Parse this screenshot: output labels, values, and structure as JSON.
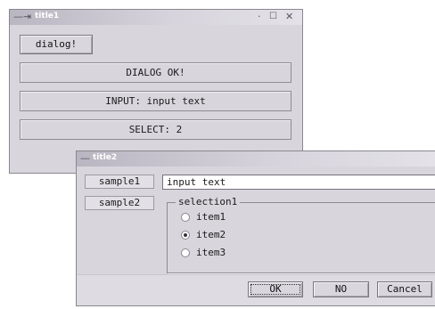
{
  "window1": {
    "title": "title1",
    "dialog_button": "dialog!",
    "status_dialog": "DIALOG OK!",
    "status_input": "INPUT: input text",
    "status_select": "SELECT: 2"
  },
  "window2": {
    "title": "title2",
    "labels": [
      "sample1",
      "sample2"
    ],
    "text_value": "input text",
    "group_title": "selection1",
    "radio_items": [
      {
        "label": "item1",
        "checked": false
      },
      {
        "label": "item2",
        "checked": true
      },
      {
        "label": "item3",
        "checked": false
      }
    ],
    "buttons": {
      "ok": "OK",
      "no": "NO",
      "cancel": "Cancel"
    }
  },
  "icons": {
    "window_menu": "minus-glyph",
    "pin": "pin-glyph",
    "minimize": "dot-glyph",
    "maximize": "square-glyph",
    "close": "x-glyph"
  }
}
